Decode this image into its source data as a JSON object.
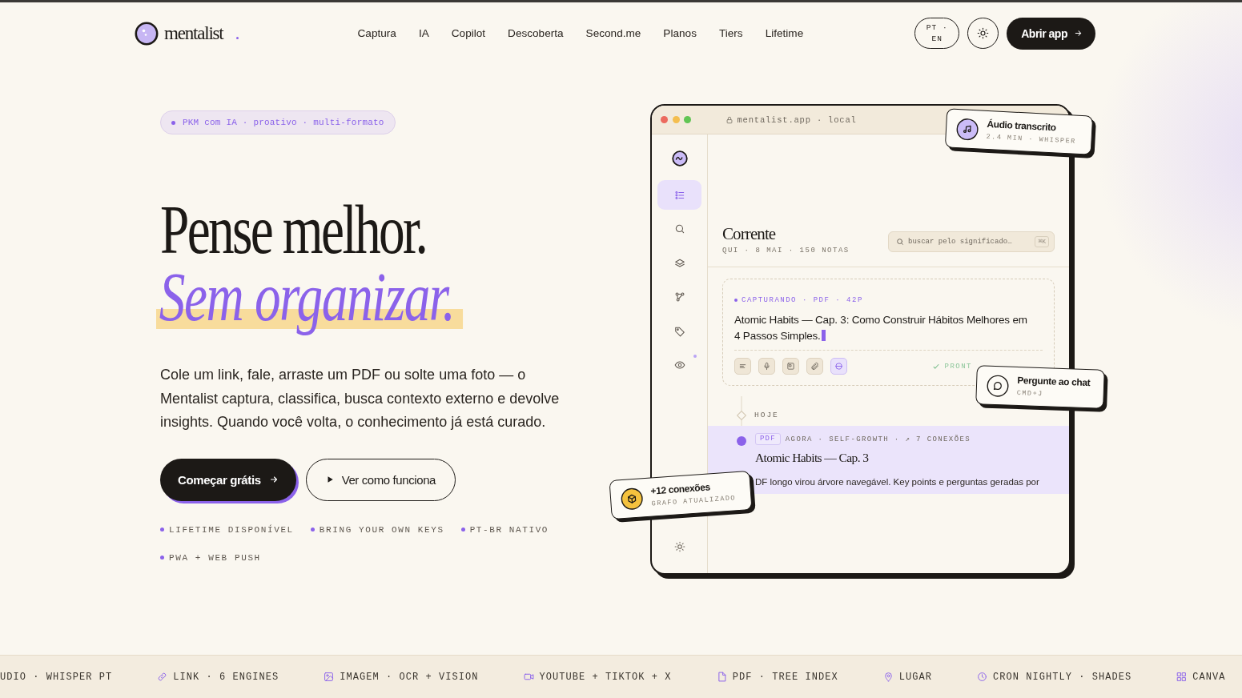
{
  "header": {
    "logo": {
      "name": "mentalist"
    },
    "nav": [
      "Captura",
      "IA",
      "Copilot",
      "Descoberta",
      "Second.me",
      "Planos",
      "Tiers",
      "Lifetime"
    ],
    "lang_toggle": {
      "lines": [
        "PT ·",
        "EN"
      ]
    },
    "cta": {
      "label": "Abrir app"
    }
  },
  "hero": {
    "badge": "PKM com IA · proativo · multi-formato",
    "title_line_1": "Pense melhor.",
    "title_line_2": "Sem organizar.",
    "paragraph": "Cole um link, fale, arraste um PDF ou solte uma foto — o Mentalist captura, classifica, busca contexto externo e devolve insights. Quando você volta, o conhecimento já está curado.",
    "buttons": [
      {
        "kind": "primary",
        "label": "Começar grátis"
      },
      {
        "kind": "secondary",
        "label": "Ver como funciona"
      }
    ],
    "tags": [
      "LIFETIME DISPONÍVEL",
      "BRING YOUR OWN KEYS",
      "PT-BR NATIVO",
      "PWA + WEB PUSH"
    ]
  },
  "app_preview": {
    "window": {
      "address": "mentalist.app · local"
    },
    "sidebar": {
      "items": [
        {
          "kind": "list",
          "selected": true,
          "notify": false
        },
        {
          "kind": "search",
          "selected": false,
          "notify": false
        },
        {
          "kind": "layers",
          "selected": false,
          "notify": false
        },
        {
          "kind": "graph",
          "selected": false,
          "notify": false
        },
        {
          "kind": "tag",
          "selected": false,
          "notify": false
        },
        {
          "kind": "eye",
          "selected": false,
          "notify": true
        }
      ]
    },
    "header": {
      "title": "Corrente",
      "subtitle": "QUI · 8 MAI · 150 NOTAS",
      "search": {
        "placeholder": "buscar pelo significado…",
        "shortcut": "⌘K"
      }
    },
    "capture_card": {
      "status_line": "CAPTURANDO · PDF · 42P",
      "title": "Atomic Habits — Cap. 3: Como Construir Hábitos Melhores em 4 Passos Simples.",
      "tools": [
        {
          "kind": "text",
          "selected": false
        },
        {
          "kind": "audio",
          "selected": false
        },
        {
          "kind": "image",
          "selected": false
        },
        {
          "kind": "file",
          "selected": false
        },
        {
          "kind": "web",
          "selected": true
        }
      ],
      "status": "PRONT"
    },
    "timeline": {
      "day_label": "HOJE",
      "entries": [
        {
          "selected": true,
          "tag": "PDF",
          "meta": "AGORA · SELF-GROWTH · ↗ 7 CONEXÕES",
          "title": "Atomic Habits — Cap. 3",
          "summary": "DF longo virou árvore navegável. Key points e perguntas geradas por"
        }
      ]
    },
    "toasts": [
      {
        "kind": "audio",
        "title": "Áudio transcrito",
        "detail": "2.4 MIN · WHISPER"
      },
      {
        "kind": "chat",
        "title": "Pergunte ao chat",
        "detail": "CMD+J"
      },
      {
        "kind": "graph",
        "title": "+12 conexões",
        "detail": "GRAFO ATUALIZADO"
      }
    ]
  },
  "ticker": {
    "items": [
      {
        "kind": "plain",
        "label": "UDIO · WHISPER PT"
      },
      {
        "kind": "link",
        "label": "LINK · 6 ENGINES"
      },
      {
        "kind": "image",
        "label": "IMAGEM · OCR + VISION"
      },
      {
        "kind": "video",
        "label": "YOUTUBE + TIKTOK + X"
      },
      {
        "kind": "document",
        "label": "PDF · TREE INDEX"
      },
      {
        "kind": "place",
        "label": "LUGAR"
      },
      {
        "kind": "schedule",
        "label": "CRON NIGHTLY · SHADES"
      },
      {
        "kind": "canvas",
        "label": "CANVA"
      }
    ]
  }
}
